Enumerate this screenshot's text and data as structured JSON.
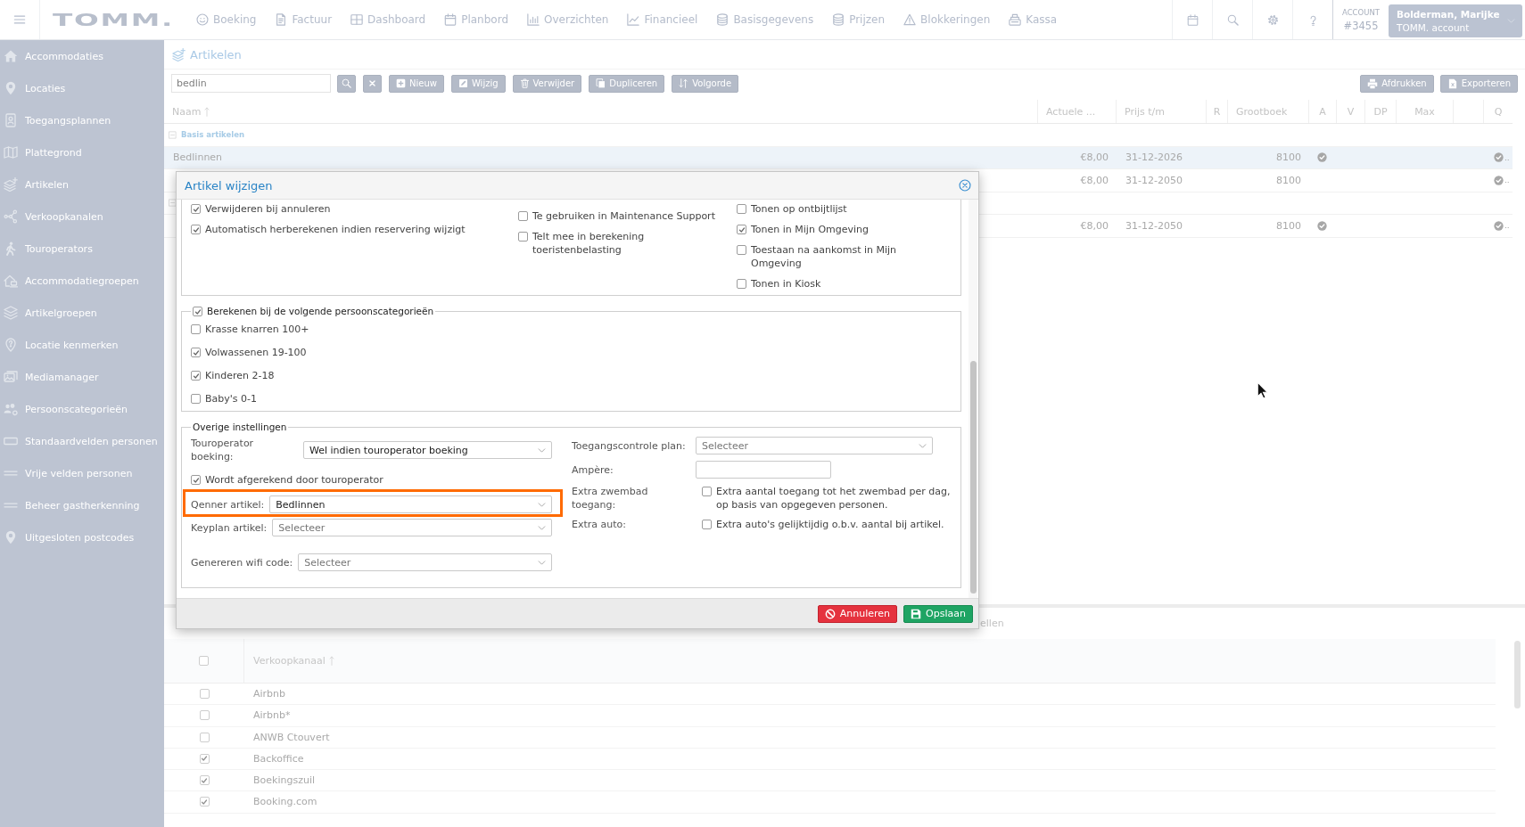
{
  "top_bar": {
    "logo": "TOMM.",
    "nav": [
      "Boeking",
      "Factuur",
      "Dashboard",
      "Planbord",
      "Overzichten",
      "Financieel",
      "Basisgegevens",
      "Prijzen",
      "Blokkeringen",
      "Kassa"
    ],
    "account": {
      "label": "ACCOUNT",
      "number": "#3455"
    },
    "user": {
      "name": "Bolderman, Marijke",
      "account": "TOMM. account"
    }
  },
  "sidebar": {
    "items": [
      "Accommodaties",
      "Locaties",
      "Toegangsplannen",
      "Plattegrond",
      "Artikelen",
      "Verkoopkanalen",
      "Touroperators",
      "Accommodatiegroepen",
      "Artikelgroepen",
      "Locatie kenmerken",
      "Mediamanager",
      "Persoonscategorieën",
      "Standaardvelden personen",
      "Vrije velden personen",
      "Beheer gastherkenning",
      "Uitgesloten postcodes"
    ]
  },
  "page": {
    "title": "Artikelen"
  },
  "toolbar": {
    "search": {
      "value": "bedlin"
    },
    "buttons": [
      "Nieuw",
      "Wijzig",
      "Verwijder",
      "Dupliceren",
      "Volgorde"
    ],
    "right_buttons": [
      "Afdrukken",
      "Exporteren"
    ]
  },
  "table": {
    "columns": [
      {
        "label": "Naam",
        "sorted": true
      },
      {
        "label": "Actuele ...",
        "sorted": false
      },
      {
        "label": "Prijs t/m",
        "sorted": false
      },
      {
        "label": "R",
        "sorted": false
      },
      {
        "label": "Grootboek",
        "sorted": false
      },
      {
        "label": "A",
        "sorted": false
      },
      {
        "label": "V",
        "sorted": false
      },
      {
        "label": "DP",
        "sorted": false
      },
      {
        "label": "Max",
        "sorted": false
      },
      {
        "label": "Q",
        "sorted": false
      }
    ],
    "rows": [
      {
        "kind": "group",
        "label": "Basis artikelen",
        "expanded": true
      },
      {
        "kind": "item",
        "selected": true,
        "naam": "Bedlinnen",
        "actuele": "€8,00",
        "prijs_tm": "31-12-2026",
        "grootboek": "8100",
        "a": true,
        "q": true,
        "q_text": ".."
      },
      {
        "kind": "item",
        "selected": false,
        "actuele": "€8,00",
        "prijs_tm": "31-12-2050",
        "grootboek": "8100",
        "a": false,
        "q": true,
        "q_text": ".."
      },
      {
        "kind": "group",
        "expanded": true
      },
      {
        "kind": "item",
        "selected": false,
        "actuele": "€8,00",
        "prijs_tm": "31-12-2050",
        "grootboek": "8100",
        "a": true,
        "q": true,
        "q_text": ".."
      }
    ]
  },
  "detail_tabs": [
    "ellen"
  ],
  "channels": {
    "select_all_checked": false,
    "column": {
      "label": "Verkoopkanaal",
      "sorted": true
    },
    "rows": [
      {
        "label": "Airbnb",
        "checked": false
      },
      {
        "label": "Airbnb*",
        "checked": false
      },
      {
        "label": "ANWB Ctouvert",
        "checked": false
      },
      {
        "label": "Backoffice",
        "checked": true
      },
      {
        "label": "Boekingszuil",
        "checked": true
      },
      {
        "label": "Booking.com",
        "checked": true
      }
    ]
  },
  "dialog": {
    "title": "Artikel wijzigen",
    "top_options": {
      "columns": [
        {
          "items": [
            {
              "label": "Verwijderen bij annuleren",
              "checked": true
            },
            {
              "label": "Automatisch herberekenen indien reservering wijzigt",
              "checked": true
            }
          ]
        },
        {
          "items": [
            {
              "label": "Te gebruiken in Maintenance Support",
              "checked": false
            },
            {
              "label": "Telt mee in berekening toeristenbelasting",
              "checked": false
            }
          ]
        },
        {
          "items": [
            {
              "label": "Tonen op ontbijtlijst",
              "checked": false
            },
            {
              "label": "Tonen in Mijn Omgeving",
              "checked": true
            },
            {
              "label": "Toestaan na aankomst in Mijn Omgeving",
              "checked": false
            },
            {
              "label": "Tonen in Kiosk",
              "checked": false
            }
          ]
        }
      ]
    },
    "person_categories": {
      "label": "Berekenen bij de volgende persoonscategorieën",
      "checked": true,
      "items": [
        {
          "label": "Krasse knarren 100+",
          "checked": false
        },
        {
          "label": "Volwassenen 19-100",
          "checked": true
        },
        {
          "label": "Kinderen 2-18",
          "checked": true
        },
        {
          "label": "Baby's 0-1",
          "checked": false
        }
      ]
    },
    "other_settings": {
      "legend": "Overige instellingen",
      "left": [
        {
          "kind": "select",
          "label": "Touroperator boeking:",
          "value": "Wel indien touroperator boeking",
          "highlighted": false
        },
        {
          "kind": "checkbox",
          "label": "Wordt afgerekend door touroperator",
          "checked": true,
          "highlighted": false
        },
        {
          "kind": "select",
          "label": "Qenner artikel:",
          "value": "Bedlinnen",
          "highlighted": true
        },
        {
          "kind": "select",
          "label": "Keyplan artikel:",
          "placeholder": "Selecteer",
          "highlighted": false
        },
        {
          "kind": "select",
          "label": "Genereren wifi code:",
          "placeholder": "Selecteer",
          "highlighted": false
        }
      ],
      "right": [
        {
          "kind": "select",
          "label": "Toegangscontrole plan:",
          "placeholder": "Selecteer"
        },
        {
          "kind": "input",
          "label": "Ampère:"
        },
        {
          "kind": "checkbox",
          "label": "Extra zwembad toegang:",
          "text": "Extra aantal toegang tot het zwembad per dag, op basis van opgegeven personen.",
          "checked": false
        },
        {
          "kind": "checkbox",
          "label": "Extra auto:",
          "text": "Extra auto's gelijktijdig o.b.v. aantal bij artikel.",
          "checked": false
        }
      ]
    },
    "buttons": [
      {
        "kind": "cancel",
        "label": "Annuleren"
      },
      {
        "kind": "save",
        "label": "Opslaan"
      }
    ]
  }
}
